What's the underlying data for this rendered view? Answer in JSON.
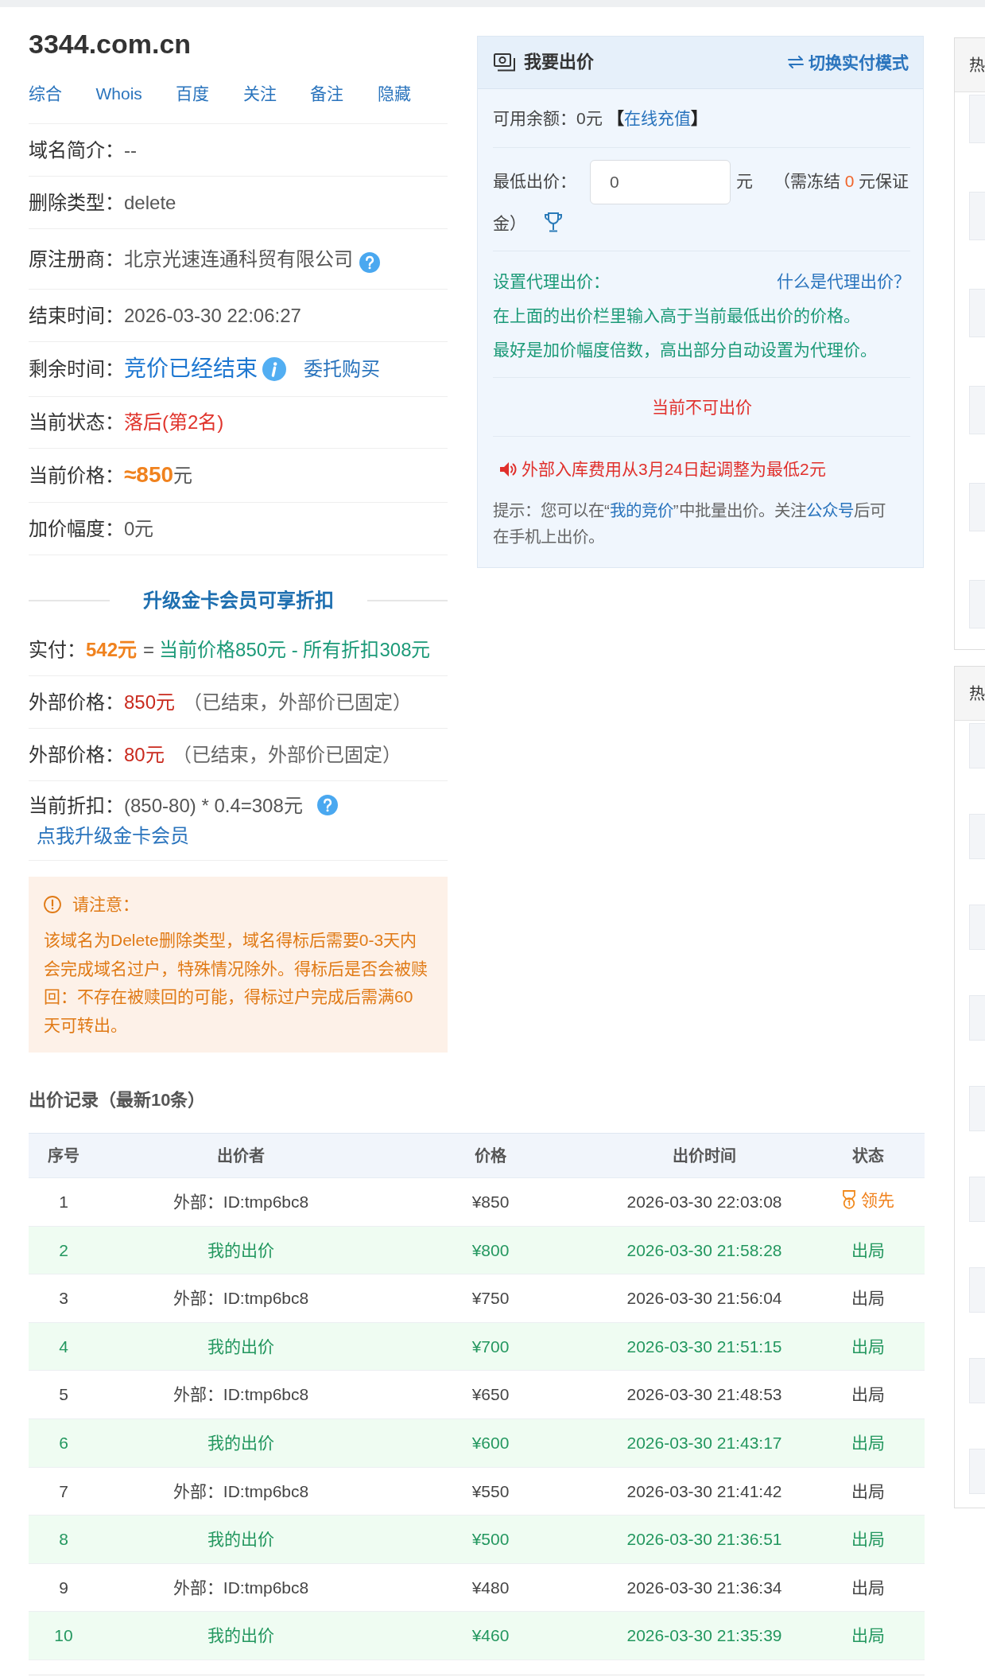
{
  "domain": {
    "name": "3344.com.cn",
    "links": [
      "综合",
      "Whois",
      "百度",
      "关注",
      "备注",
      "隐藏"
    ]
  },
  "info": [
    {
      "kind": "plain",
      "label": "域名简介：",
      "value": "--"
    },
    {
      "kind": "plain",
      "label": "删除类型：",
      "value": "delete"
    },
    {
      "kind": "help",
      "label": "原注册商：",
      "value": "北京光速连通科贸有限公司"
    },
    {
      "kind": "plain",
      "label": "结束时间：",
      "value": "2026-03-30 22:06:27"
    },
    {
      "kind": "ended",
      "label": "剩余时间：",
      "value": "竞价已经结束",
      "link": "委托购买"
    },
    {
      "kind": "alert",
      "label": "当前状态：",
      "value": "落后(第2名)"
    },
    {
      "kind": "price",
      "label": "当前价格：",
      "value": "≈850",
      "unit": "元"
    },
    {
      "kind": "plain",
      "label": "加价幅度：",
      "value": "0元"
    }
  ],
  "discount": {
    "title": "升级金卡会员可享折扣",
    "pay": {
      "label": "实付：",
      "amount": "542元",
      "eq": "=",
      "formula": "当前价格850元 - 所有折扣308元"
    },
    "external": [
      {
        "label": "外部价格：",
        "price": "850元",
        "note": "（已结束，外部价已固定）"
      },
      {
        "label": "外部价格：",
        "price": "80元",
        "note": "（已结束，外部价已固定）"
      }
    ],
    "current": {
      "label": "当前折扣：",
      "value": "(850-80) * 0.4=308元",
      "link": "点我升级金卡会员"
    }
  },
  "notice": {
    "title": "请注意：",
    "text": "该域名为Delete删除类型，域名得标后需要0-3天内会完成域名过户，特殊情况除外。得标后是否会被赎回：不存在被赎回的可能，得标过户完成后需满60天可转出。"
  },
  "bid_panel": {
    "title": "我要出价",
    "switch_link": "切换实付模式",
    "balance": {
      "label": "可用余额：",
      "amount": "0元",
      "brackets": [
        "【",
        "】"
      ],
      "link": "在线充值"
    },
    "min_bid": {
      "label": "最低出价：",
      "value": "0",
      "unit": "元",
      "note_before": "（需冻结 ",
      "deposit": "0",
      "note_after": " 元保证金）"
    },
    "proxy": {
      "title": "设置代理出价：",
      "help_link": "什么是代理出价？",
      "lines": [
        "在上面的出价栏里输入高于当前最低出价的价格。",
        "最好是加价幅度倍数，高出部分自动设置为代理价。"
      ]
    },
    "status": "当前不可出价",
    "announcement": "外部入库费用从3月24日起调整为最低2元",
    "tip": [
      {
        "kind": "text",
        "text": "提示：您可以在“"
      },
      {
        "kind": "link",
        "text": "我的竞价"
      },
      {
        "kind": "text",
        "text": "”中批量出价。关注"
      },
      {
        "kind": "link",
        "text": "公众号"
      },
      {
        "kind": "text",
        "text": "后可在手机上出价。"
      }
    ]
  },
  "bids": {
    "title": "出价记录（最新10条）",
    "columns": [
      "序号",
      "出价者",
      "价格",
      "出价时间",
      "状态"
    ],
    "rows": [
      {
        "no": "1",
        "bidder": "外部：ID:tmp6bc8",
        "price": "¥850",
        "time": "2026-03-30 22:03:08",
        "status": "领先",
        "mine": false,
        "leading": true
      },
      {
        "no": "2",
        "bidder": "我的出价",
        "price": "¥800",
        "time": "2026-03-30 21:58:28",
        "status": "出局",
        "mine": true,
        "leading": false
      },
      {
        "no": "3",
        "bidder": "外部：ID:tmp6bc8",
        "price": "¥750",
        "time": "2026-03-30 21:56:04",
        "status": "出局",
        "mine": false,
        "leading": false
      },
      {
        "no": "4",
        "bidder": "我的出价",
        "price": "¥700",
        "time": "2026-03-30 21:51:15",
        "status": "出局",
        "mine": true,
        "leading": false
      },
      {
        "no": "5",
        "bidder": "外部：ID:tmp6bc8",
        "price": "¥650",
        "time": "2026-03-30 21:48:53",
        "status": "出局",
        "mine": false,
        "leading": false
      },
      {
        "no": "6",
        "bidder": "我的出价",
        "price": "¥600",
        "time": "2026-03-30 21:43:17",
        "status": "出局",
        "mine": true,
        "leading": false
      },
      {
        "no": "7",
        "bidder": "外部：ID:tmp6bc8",
        "price": "¥550",
        "time": "2026-03-30 21:41:42",
        "status": "出局",
        "mine": false,
        "leading": false
      },
      {
        "no": "8",
        "bidder": "我的出价",
        "price": "¥500",
        "time": "2026-03-30 21:36:51",
        "status": "出局",
        "mine": true,
        "leading": false
      },
      {
        "no": "9",
        "bidder": "外部：ID:tmp6bc8",
        "price": "¥480",
        "time": "2026-03-30 21:36:34",
        "status": "出局",
        "mine": false,
        "leading": false
      },
      {
        "no": "10",
        "bidder": "我的出价",
        "price": "¥460",
        "time": "2026-03-30 21:35:39",
        "status": "出局",
        "mine": true,
        "leading": false
      }
    ]
  },
  "side_panels": [
    {
      "title": "热",
      "rows": [
        {
          "shaded": true
        },
        {
          "shaded": false
        },
        {
          "shaded": true
        },
        {
          "shaded": false
        },
        {
          "shaded": true
        },
        {
          "shaded": false
        },
        {
          "shaded": true
        },
        {
          "shaded": false
        },
        {
          "shaded": true
        },
        {
          "shaded": false
        },
        {
          "shaded": true
        }
      ]
    },
    {
      "title": "热",
      "rows": [
        {
          "shaded": true
        },
        {
          "shaded": false
        },
        {
          "shaded": true
        },
        {
          "shaded": false
        },
        {
          "shaded": true
        },
        {
          "shaded": false
        },
        {
          "shaded": true
        },
        {
          "shaded": false
        },
        {
          "shaded": true
        },
        {
          "shaded": false
        },
        {
          "shaded": true
        },
        {
          "shaded": false
        },
        {
          "shaded": true
        },
        {
          "shaded": false
        },
        {
          "shaded": true
        },
        {
          "shaded": false
        },
        {
          "shaded": true
        }
      ]
    }
  ]
}
